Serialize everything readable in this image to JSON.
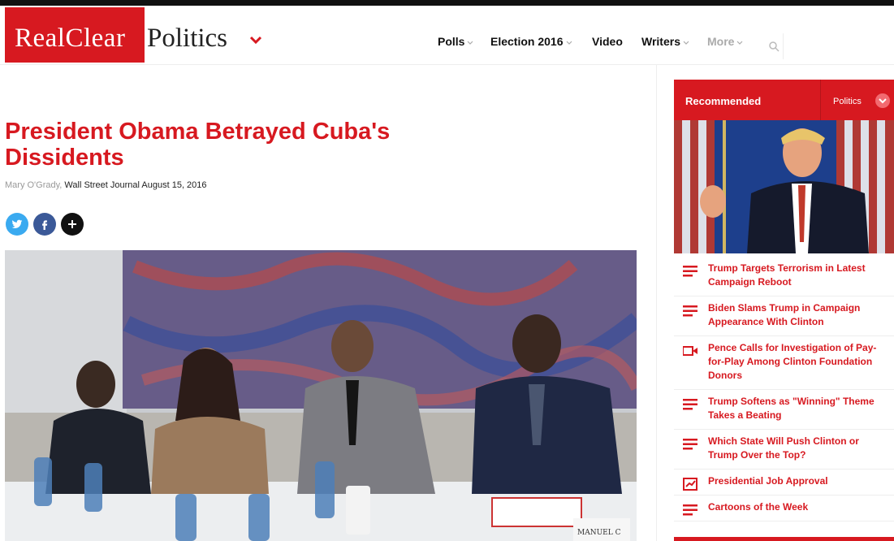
{
  "logo": {
    "part1": "RealClear",
    "part2": "Politics"
  },
  "nav": {
    "items": [
      {
        "label": "Polls"
      },
      {
        "label": "Election 2016"
      },
      {
        "label": "Video"
      },
      {
        "label": "Writers"
      },
      {
        "label": "More"
      }
    ]
  },
  "search": {
    "placeholder": ""
  },
  "article": {
    "title": "President Obama Betrayed Cuba's Dissidents",
    "author": "Mary O'Grady",
    "source": "Wall Street Journal",
    "date": "August 15, 2016"
  },
  "share": {
    "icons": [
      "twitter-icon",
      "facebook-icon",
      "plus-icon"
    ]
  },
  "photo": {
    "nameplates": [
      "MANUEL C"
    ]
  },
  "recommended": {
    "title": "Recommended",
    "selected": "Politics",
    "items": [
      {
        "icon": "article-list-icon",
        "title": "Trump Targets Terrorism in Latest Campaign Reboot"
      },
      {
        "icon": "article-list-icon",
        "title": "Biden Slams Trump in Campaign Appearance With Clinton"
      },
      {
        "icon": "video-camera-icon",
        "title": "Pence Calls for Investigation of Pay-for-Play Among Clinton Foundation Donors"
      },
      {
        "icon": "article-list-icon",
        "title": "Trump Softens as \"Winning\" Theme Takes a Beating"
      },
      {
        "icon": "article-list-icon",
        "title": "Which State Will Push Clinton or Trump Over the Top?"
      },
      {
        "icon": "chart-icon",
        "title": "Presidential Job Approval"
      },
      {
        "icon": "article-list-icon",
        "title": "Cartoons of the Week"
      }
    ]
  },
  "colors": {
    "brand_red": "#d71920",
    "text": "#111111",
    "muted": "#999999"
  }
}
